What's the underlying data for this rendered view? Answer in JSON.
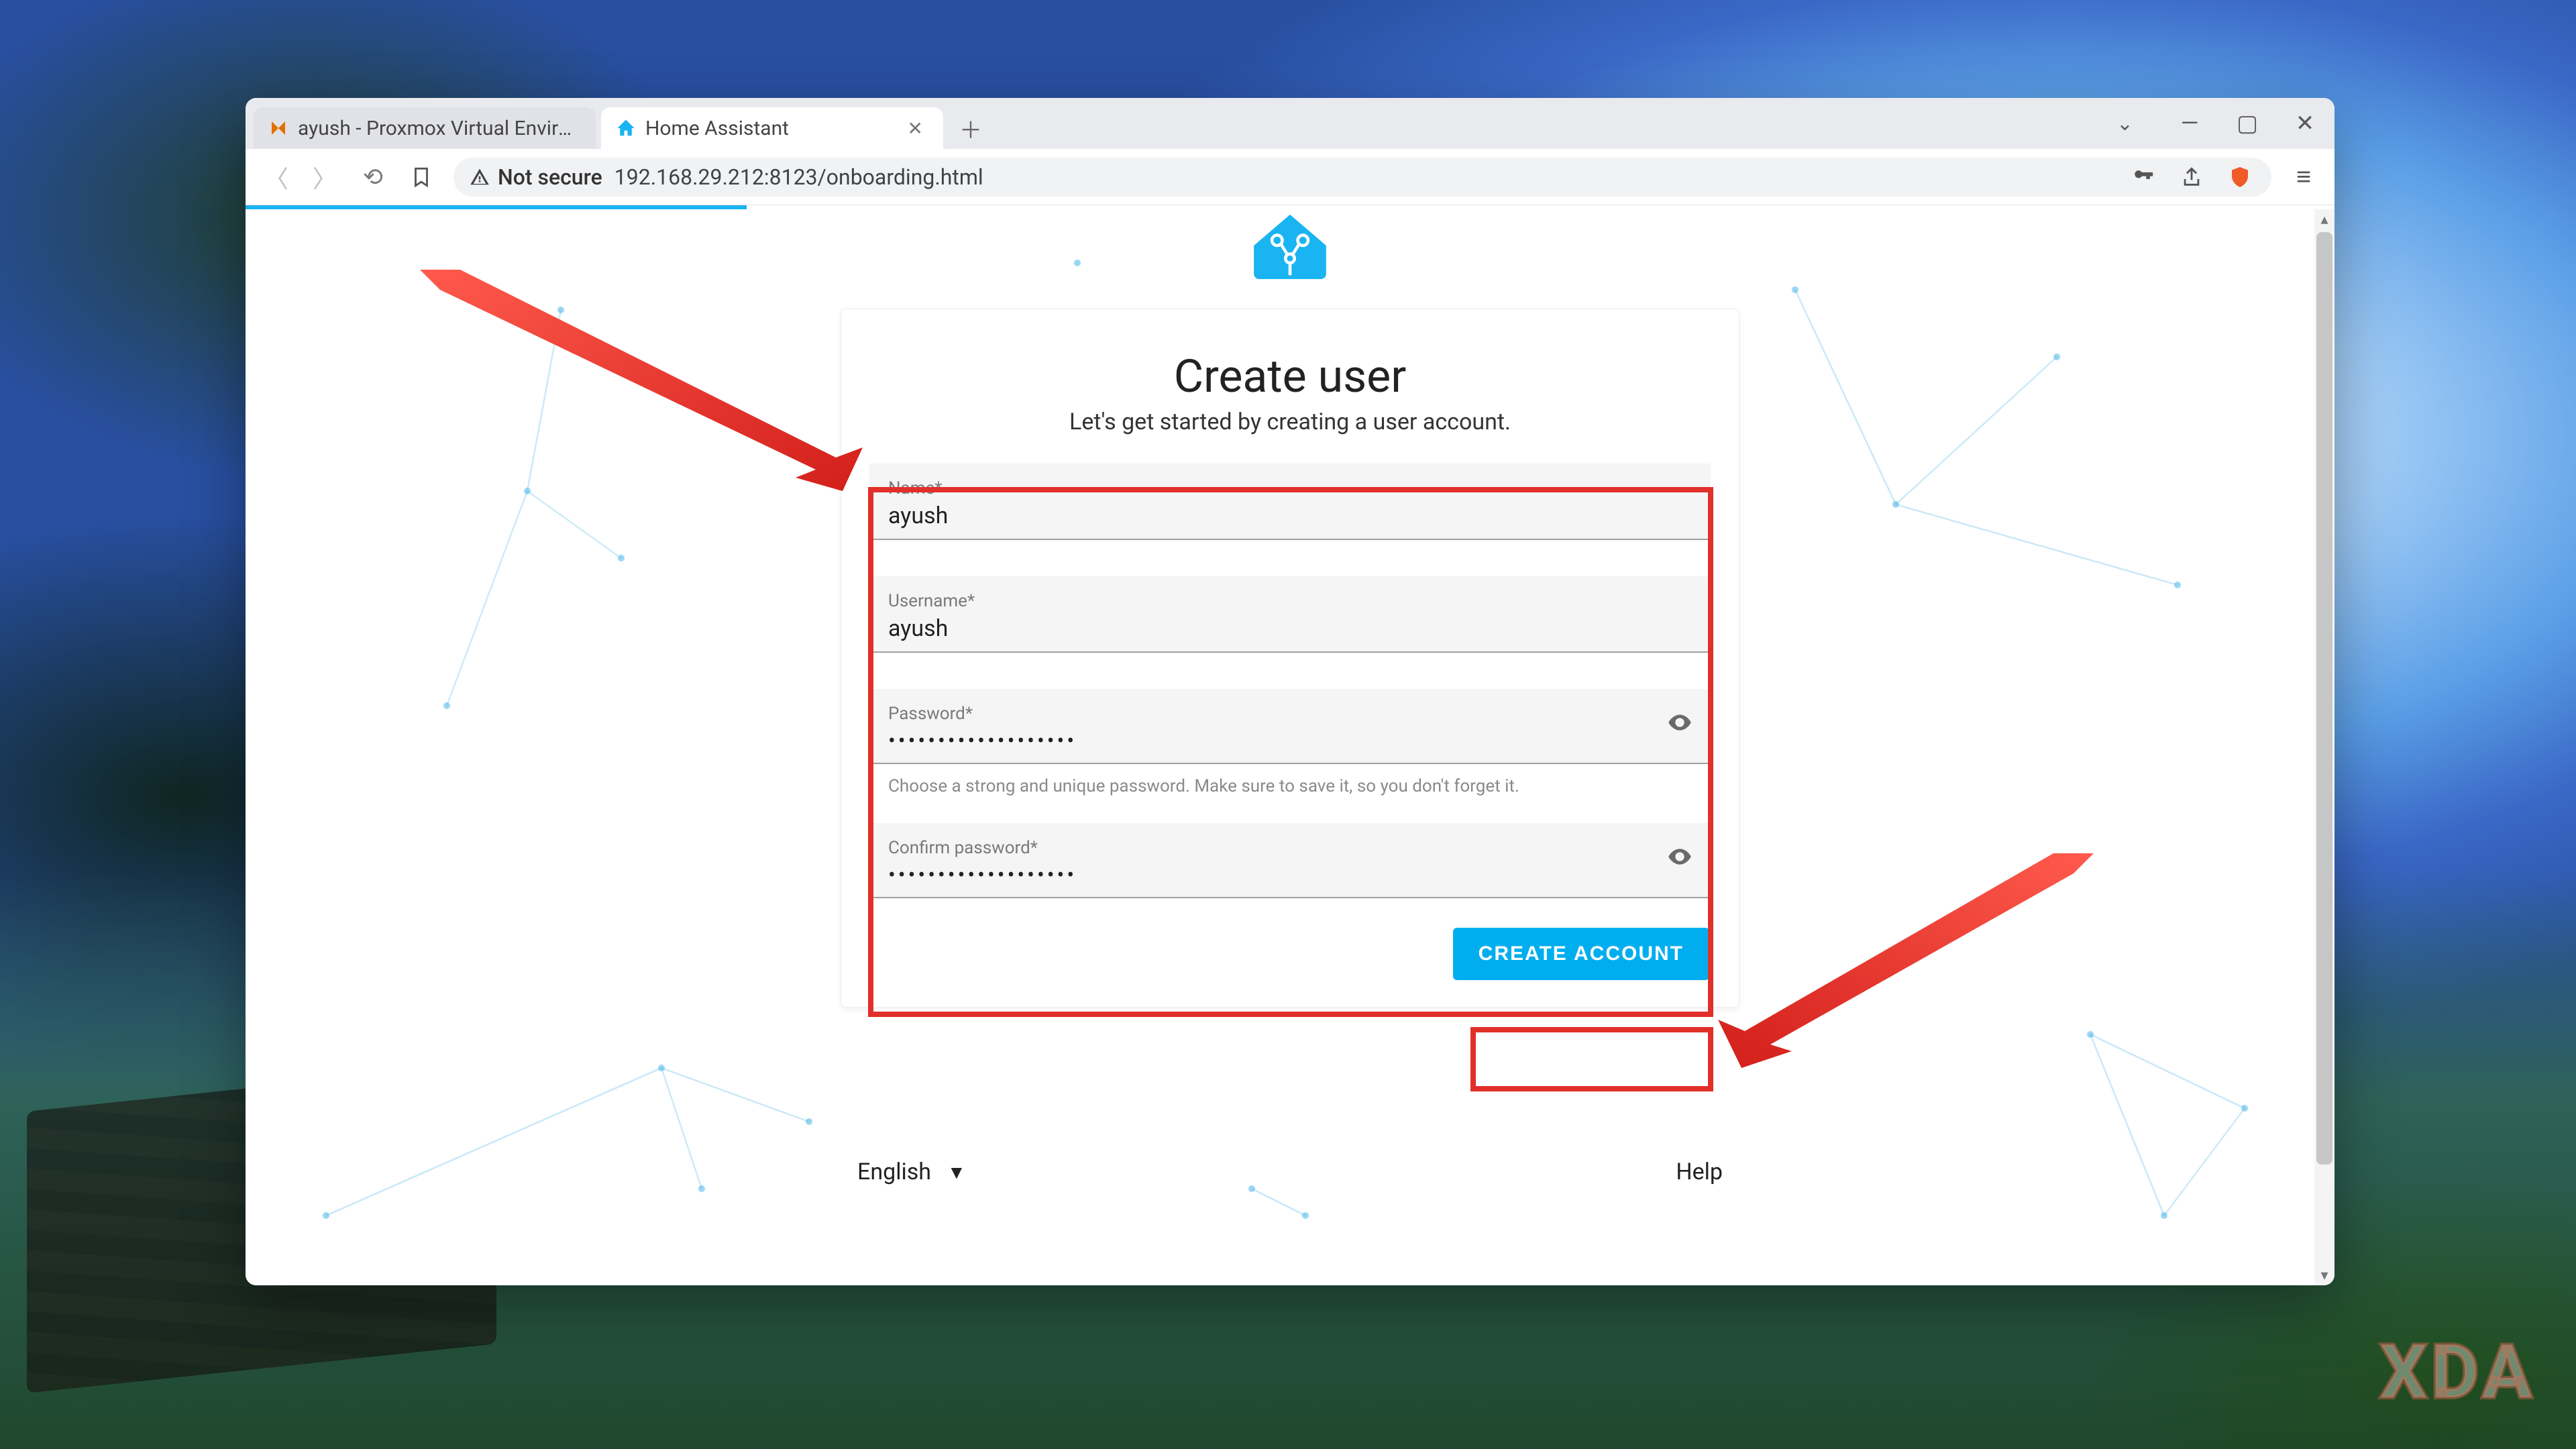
{
  "browser": {
    "tabs": [
      {
        "title": "ayush - Proxmox Virtual Environme",
        "active": false,
        "icon": "proxmox"
      },
      {
        "title": "Home Assistant",
        "active": true,
        "icon": "home-assistant"
      }
    ],
    "address_security_label": "Not secure",
    "address_url": "192.168.29.212:8123/onboarding.html"
  },
  "page": {
    "title": "Create user",
    "subtitle": "Let's get started by creating a user account.",
    "fields": {
      "name": {
        "label": "Name*",
        "value": "ayush"
      },
      "username": {
        "label": "Username*",
        "value": "ayush"
      },
      "password": {
        "label": "Password*",
        "value": "•••••••••••••••••••"
      },
      "confirm": {
        "label": "Confirm password*",
        "value": "•••••••••••••••••••"
      }
    },
    "password_hint": "Choose a strong and unique password. Make sure to save it, so you don't forget it.",
    "create_button": "CREATE ACCOUNT",
    "language": "English",
    "help": "Help"
  },
  "watermark": "XDA"
}
